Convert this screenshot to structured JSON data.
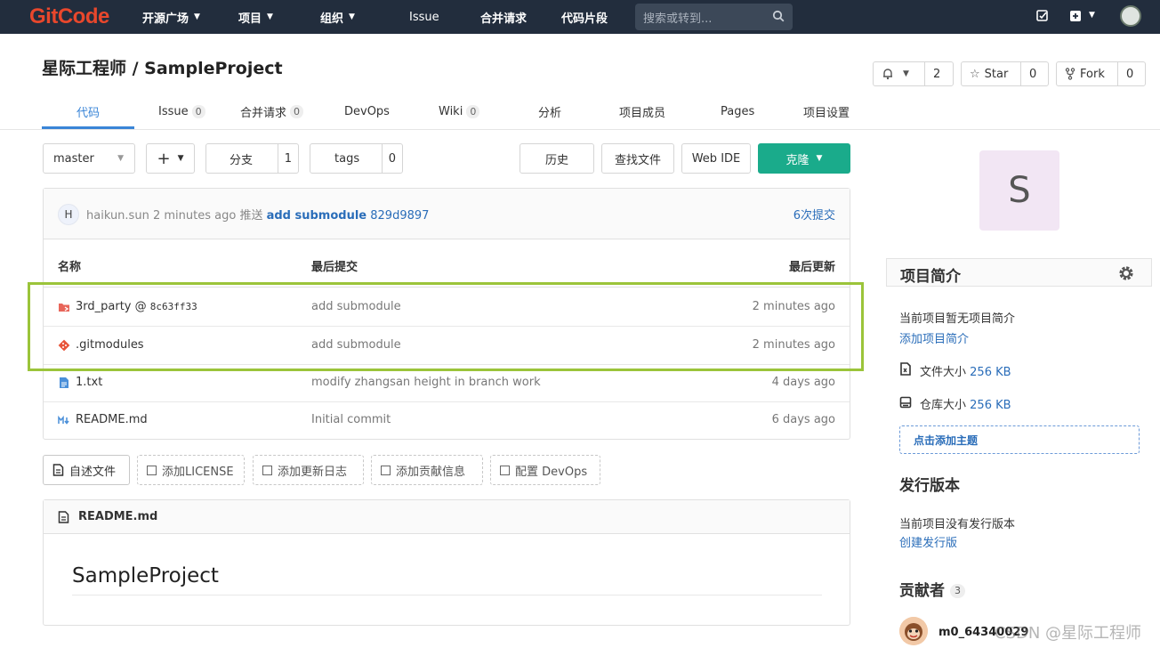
{
  "topbar": {
    "logo": "GitCode",
    "nav": [
      {
        "label": "开源广场",
        "has_menu": true
      },
      {
        "label": "项目",
        "has_menu": true
      },
      {
        "label": "组织",
        "has_menu": true
      },
      {
        "label": "Issue",
        "has_menu": false
      },
      {
        "label": "合并请求",
        "has_menu": false
      },
      {
        "label": "代码片段",
        "has_menu": false
      }
    ],
    "search_placeholder": "搜索或转到...",
    "icons": [
      "edit-icon",
      "plus-square-icon",
      "user-avatar"
    ]
  },
  "project": {
    "title": "星际工程师 / SampleProject",
    "notify_count": "2",
    "star_label": "Star",
    "star_count": "0",
    "fork_label": "Fork",
    "fork_count": "0"
  },
  "tabs": [
    {
      "label": "代码",
      "count": null,
      "active": true
    },
    {
      "label": "Issue",
      "count": "0"
    },
    {
      "label": "合并请求",
      "count": "0"
    },
    {
      "label": "DevOps",
      "count": null
    },
    {
      "label": "Wiki",
      "count": "0"
    },
    {
      "label": "分析",
      "count": null
    },
    {
      "label": "项目成员",
      "count": null
    },
    {
      "label": "Pages",
      "count": null
    },
    {
      "label": "项目设置",
      "count": null
    }
  ],
  "toolbar": {
    "branch": "master",
    "plus": "+",
    "branches_label": "分支",
    "branches_count": "1",
    "tags_label": "tags",
    "tags_count": "0",
    "history": "历史",
    "find_file": "查找文件",
    "web_ide": "Web IDE",
    "clone": "克隆"
  },
  "commit": {
    "avatar_letter": "H",
    "author": "haikun.sun",
    "time": "2 minutes ago",
    "verb": "推送",
    "message": "add submodule",
    "sha": "829d9897",
    "count_label": "6次提交"
  },
  "file_table": {
    "headers": {
      "name": "名称",
      "last_commit": "最后提交",
      "last_update": "最后更新"
    },
    "rows": [
      {
        "name": "3rd_party",
        "suffix": " @ ",
        "ref": "8c63ff33",
        "message": "add submodule",
        "time": "2 minutes ago",
        "icon": "submodule-folder-icon"
      },
      {
        "name": ".gitmodules",
        "suffix": "",
        "ref": "",
        "message": "add submodule",
        "time": "2 minutes ago",
        "icon": "git-file-icon"
      },
      {
        "name": "1.txt",
        "suffix": "",
        "ref": "",
        "message": "modify zhangsan height in branch work",
        "time": "4 days ago",
        "icon": "text-file-icon"
      },
      {
        "name": "README.md",
        "suffix": "",
        "ref": "",
        "message": "Initial commit",
        "time": "6 days ago",
        "icon": "markdown-icon"
      }
    ]
  },
  "quick_actions": [
    "自述文件",
    "添加LICENSE",
    "添加更新日志",
    "添加贡献信息",
    "配置 DevOps"
  ],
  "readme": {
    "filename": "README.md",
    "heading": "SampleProject"
  },
  "sidebar": {
    "avatar_letter": "S",
    "intro_title": "项目简介",
    "intro_text": "当前项目暂无项目简介",
    "intro_link": "添加项目简介",
    "file_size_label": "文件大小",
    "file_size": "256 KB",
    "repo_size_label": "仓库大小",
    "repo_size": "256 KB",
    "add_topic": "点击添加主题",
    "release_title": "发行版本",
    "release_text": "当前项目没有发行版本",
    "release_link": "创建发行版",
    "contrib_title": "贡献者",
    "contrib_count": "3",
    "contrib_name": "m0_64340029"
  },
  "watermark": "CSDN @星际工程师",
  "colors": {
    "topbar": "#222d3d",
    "accent": "#3a85d7",
    "clone": "#1aab8b",
    "highlight": "#9bc43a",
    "logo": "#e8472c"
  }
}
